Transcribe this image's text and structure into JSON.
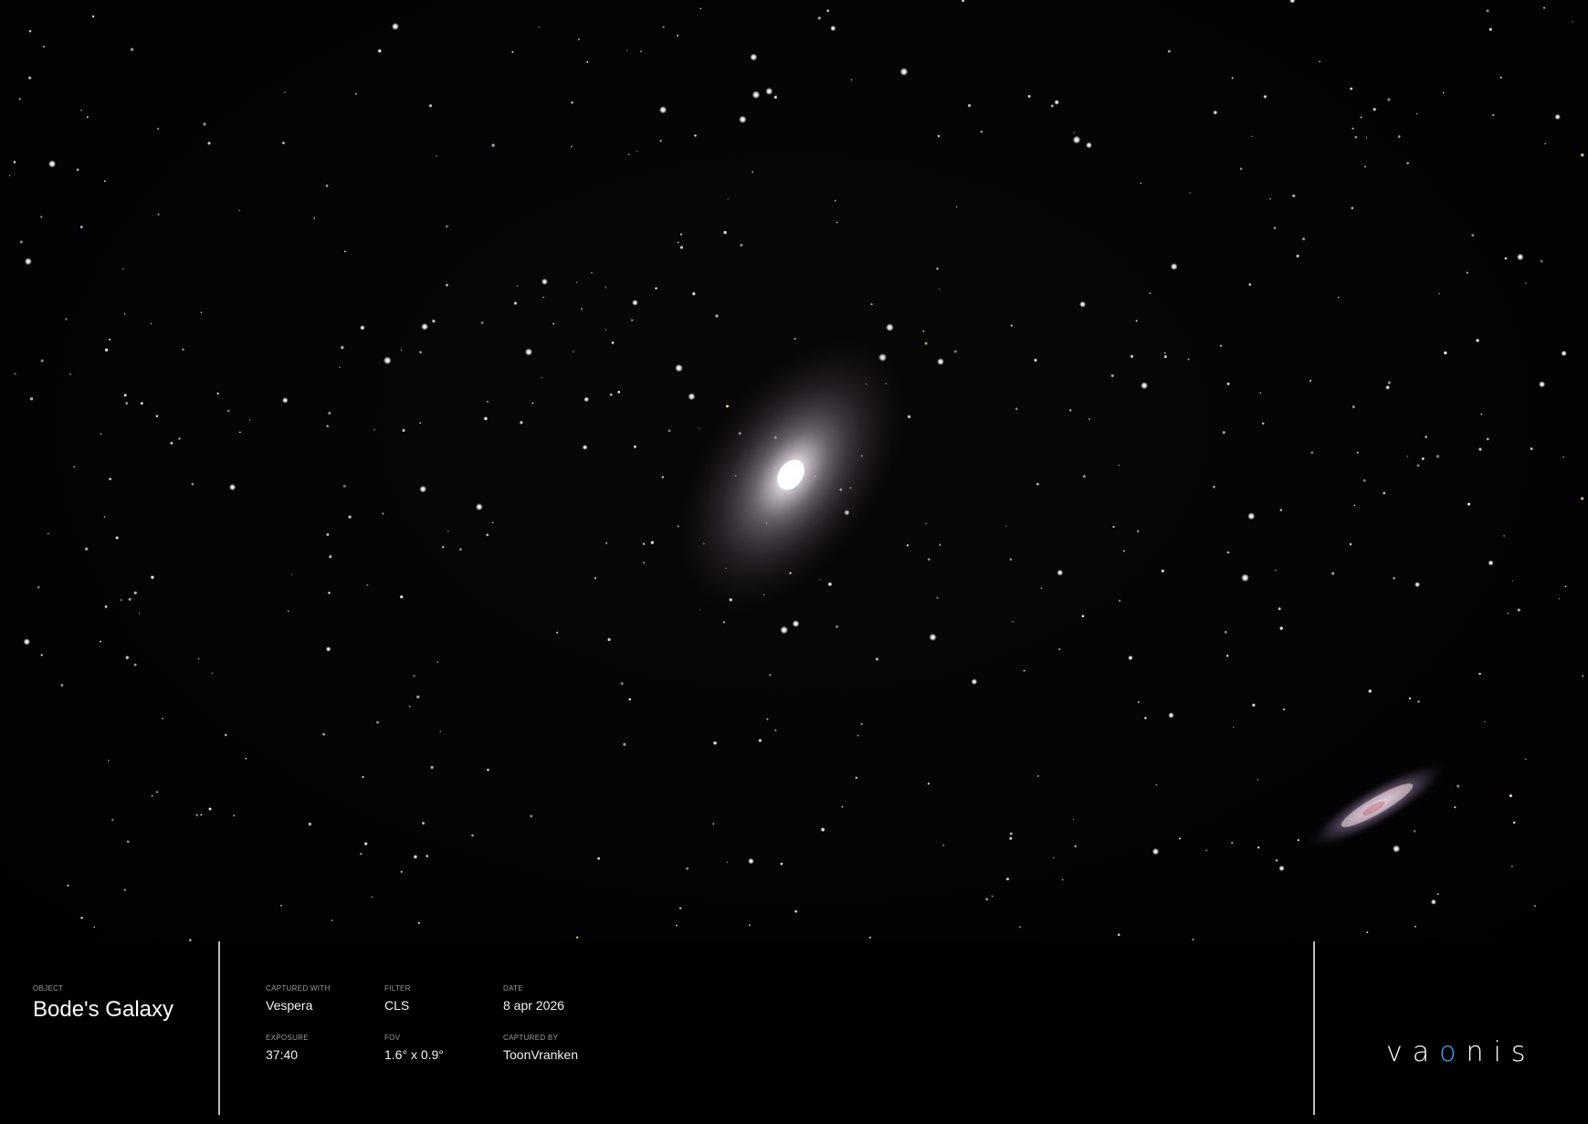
{
  "image": {
    "subject": "night sky star field",
    "galaxies": [
      "large spiral galaxy center",
      "edge-on galaxy lower right"
    ]
  },
  "caption": {
    "object_label": "OBJECT",
    "object_value": "Bode's Galaxy",
    "captured_with_label": "CAPTURED WITH",
    "captured_with_value": "Vespera",
    "filter_label": "FILTER",
    "filter_value": "CLS",
    "date_label": "DATE",
    "date_value": "8 apr 2026",
    "exposure_label": "EXPOSURE",
    "exposure_value": "37:40",
    "fov_label": "FOV",
    "fov_value": "1.6° x 0.9°",
    "captured_by_label": "CAPTURED BY",
    "captured_by_value": "ToonVranken"
  },
  "brand": {
    "logo_text": "vaonis",
    "accent_color": "#3aa6ff"
  }
}
